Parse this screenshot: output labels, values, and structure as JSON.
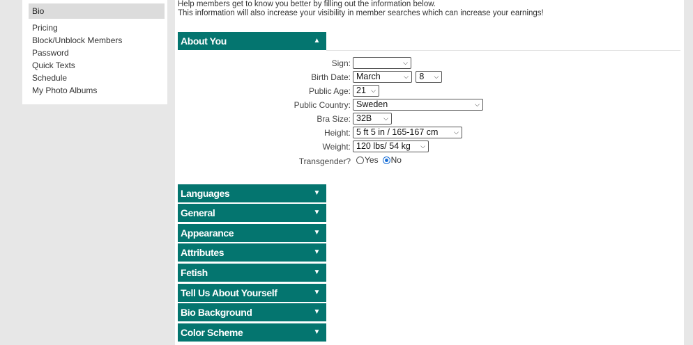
{
  "sidebar": {
    "active": "Bio",
    "items": [
      "Pricing",
      "Block/Unblock Members",
      "Password",
      "Quick Texts",
      "Schedule",
      "My Photo Albums"
    ]
  },
  "intro": {
    "line1": "Help members get to know you better by filling out the information below.",
    "line2": "This information will also increase your visibility in member searches which can increase your earnings!"
  },
  "about": {
    "title": "About You",
    "fields": {
      "sign_label": "Sign:",
      "sign_value": "",
      "birth_label": "Birth Date:",
      "birth_month": "March",
      "birth_day": "8",
      "age_label": "Public Age:",
      "age_value": "21",
      "country_label": "Public Country:",
      "country_value": "Sweden",
      "bra_label": "Bra Size:",
      "bra_value": "32B",
      "height_label": "Height:",
      "height_value": "5 ft 5 in / 165-167 cm",
      "weight_label": "Weight:",
      "weight_value": "120 lbs/ 54 kg",
      "trans_label": "Transgender?",
      "trans_yes": "Yes",
      "trans_no": "No",
      "trans_selected": "No"
    }
  },
  "sections": [
    "Languages",
    "General",
    "Appearance",
    "Attributes",
    "Fetish",
    "Tell Us About Yourself",
    "Bio Background",
    "Color Scheme"
  ],
  "colors": {
    "accent": "#04756f",
    "radio_selected": "#1a6fd6"
  },
  "icons": {
    "expanded": "caret-up-icon",
    "collapsed": "caret-down-icon",
    "select": "chevron-down-icon"
  }
}
